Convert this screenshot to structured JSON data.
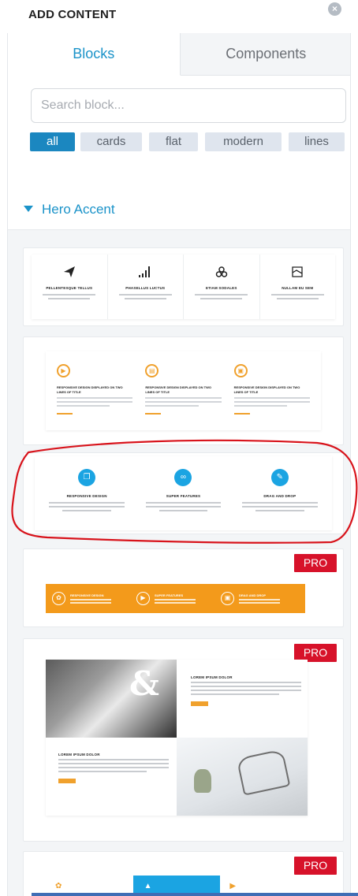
{
  "header": {
    "title": "ADD CONTENT",
    "close_glyph": "×"
  },
  "tabs": [
    {
      "label": "Blocks",
      "active": true
    },
    {
      "label": "Components",
      "active": false
    }
  ],
  "search": {
    "placeholder": "Search block..."
  },
  "filters": [
    {
      "label": "all",
      "active": true
    },
    {
      "label": "cards"
    },
    {
      "label": "flat"
    },
    {
      "label": "modern"
    },
    {
      "label": "lines"
    }
  ],
  "section": {
    "title": "Hero Accent",
    "expanded": true
  },
  "blocks": [
    {
      "name": "four-feature-columns",
      "pro": false,
      "columns": [
        {
          "icon": "paper-plane-icon",
          "title": "PELLENTESQUE TELLUS"
        },
        {
          "icon": "signal-bars-icon",
          "title": "PHASELLUS LUCTUS"
        },
        {
          "icon": "cookie-icon",
          "title": "ETIAM SODALES"
        },
        {
          "icon": "flag-icon",
          "title": "NULLAM EU SEM"
        }
      ]
    },
    {
      "name": "three-feature-orange-outline",
      "pro": false,
      "columns": [
        {
          "icon": "play-icon",
          "title": "RESPONSIVE DESIGN DISPLAYED ON TWO LINES OF TITLE"
        },
        {
          "icon": "cart-icon",
          "title": "RESPONSIVE DESIGN DISPLAYED ON TWO LINES OF TITLE"
        },
        {
          "icon": "image-icon",
          "title": "RESPONSIVE DESIGN DISPLAYED ON TWO LINES OF TITLE"
        }
      ]
    },
    {
      "name": "three-feature-blue-circles",
      "pro": false,
      "columns": [
        {
          "icon": "copy-icon",
          "title": "RESPONSIVE DESIGN"
        },
        {
          "icon": "link-icon",
          "title": "SUPER FEATURES"
        },
        {
          "icon": "wrench-icon",
          "title": "DRAG AND DROP"
        }
      ]
    },
    {
      "name": "orange-feature-bar",
      "pro": true,
      "pro_label": "PRO",
      "items": [
        {
          "icon": "cookie-icon",
          "title": "RESPONSIVE DESIGN"
        },
        {
          "icon": "play-icon",
          "title": "SUPER FEATURES"
        },
        {
          "icon": "image-icon",
          "title": "DRAG AND DROP"
        }
      ]
    },
    {
      "name": "photo-text-grid",
      "pro": true,
      "pro_label": "PRO",
      "headings": [
        "LOREM IPSUM DOLOR",
        "LOREM IPSUM DOLOR"
      ],
      "ampersand": "&"
    },
    {
      "name": "partial-icon-row",
      "pro": true,
      "pro_label": "PRO"
    }
  ]
}
